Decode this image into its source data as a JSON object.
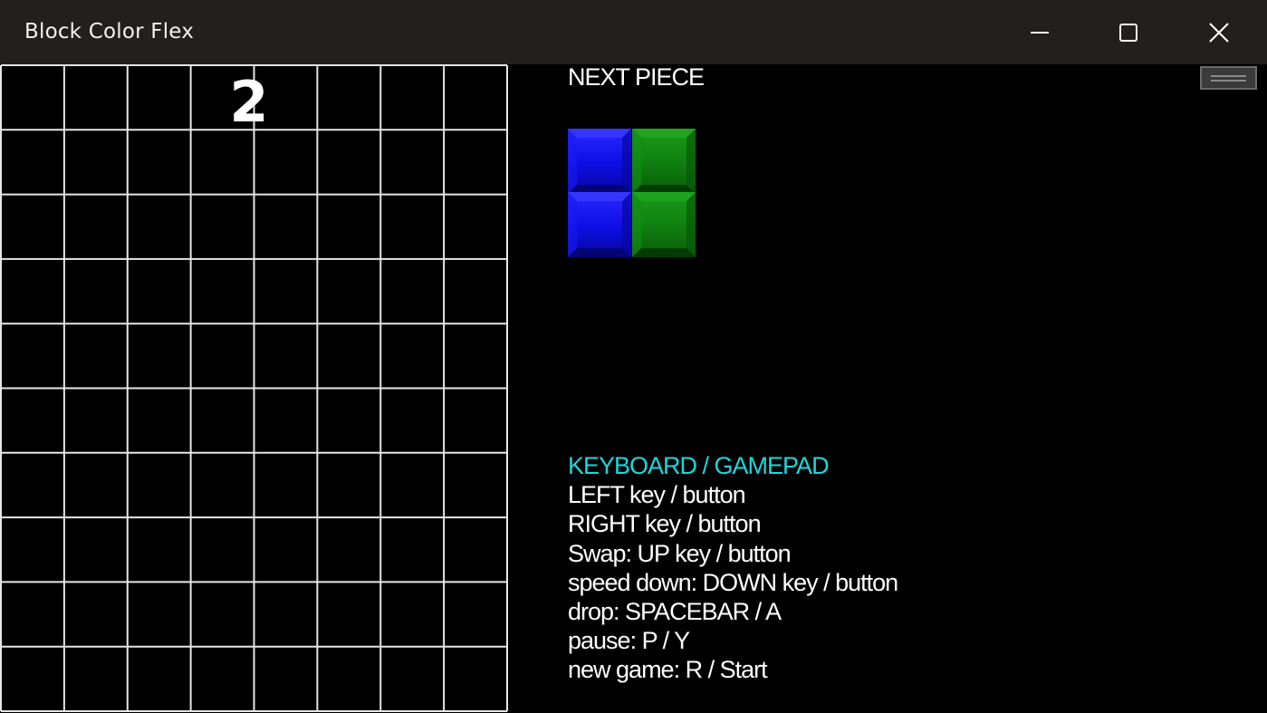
{
  "window": {
    "title": "Block Color Flex",
    "buttons": [
      "minimize-icon",
      "maximize-icon",
      "close-icon"
    ]
  },
  "board": {
    "columns": 8,
    "rows": 10,
    "score": "2",
    "grid_color": "#e6e6e6",
    "background": "#000000"
  },
  "next_piece": {
    "label": "NEXT PIECE",
    "blocks": [
      {
        "col": 0,
        "row": 0,
        "color": "blue"
      },
      {
        "col": 0,
        "row": 1,
        "color": "blue"
      },
      {
        "col": 1,
        "row": 0,
        "color": "green"
      },
      {
        "col": 1,
        "row": 1,
        "color": "green"
      }
    ]
  },
  "controls": {
    "heading": "KEYBOARD / GAMEPAD",
    "lines": [
      "LEFT key / button",
      "RIGHT key / button",
      "Swap: UP key / button",
      "speed down: DOWN key / button",
      "drop: SPACEBAR / A",
      "pause: P / Y",
      "new game: R / Start"
    ]
  },
  "colors": {
    "titlebar": "#221f1d",
    "heading_accent": "#1ed6dc",
    "blue": "#1010f0",
    "green": "#108a10"
  }
}
